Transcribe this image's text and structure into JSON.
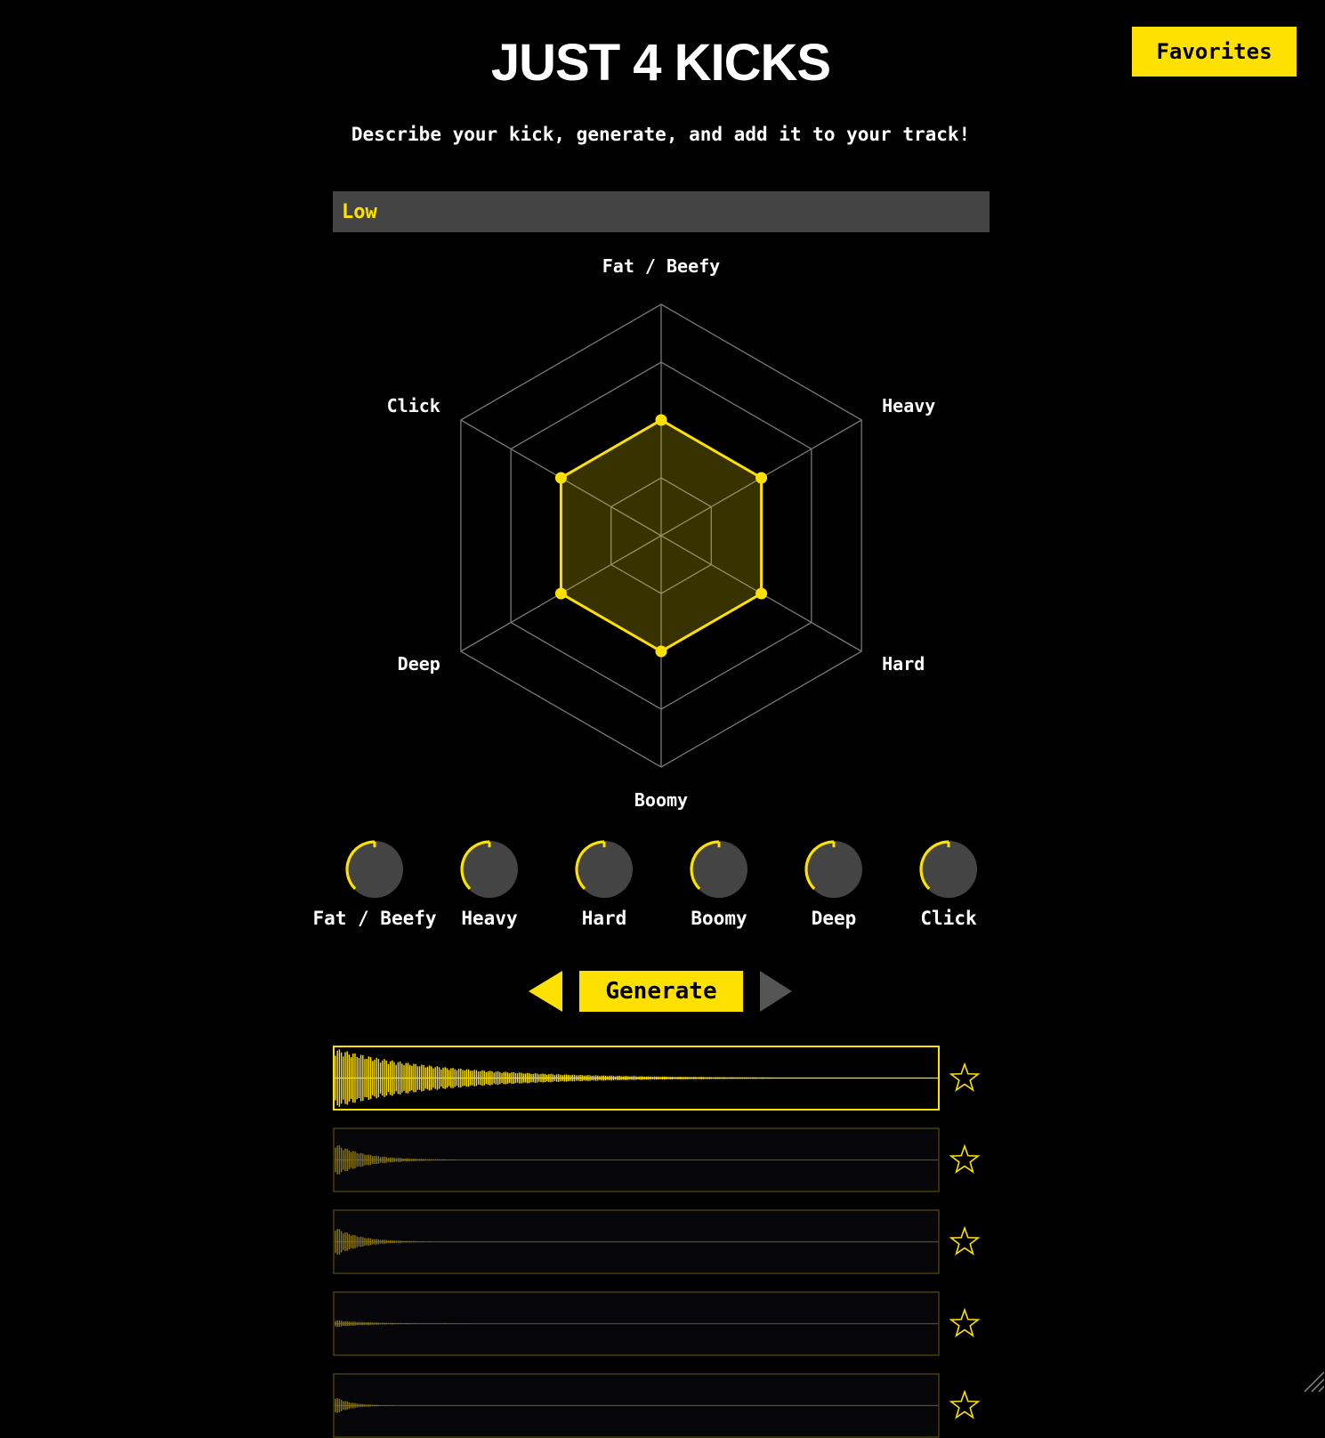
{
  "header": {
    "title": "JUST 4 KICKS",
    "subtitle": "Describe your kick, generate, and add it to your track!",
    "favorites_label": "Favorites"
  },
  "description": {
    "value": "Low"
  },
  "radar": {
    "axes": [
      "Fat / Beefy",
      "Heavy",
      "Hard",
      "Boomy",
      "Deep",
      "Click"
    ],
    "values": [
      0.5,
      0.5,
      0.5,
      0.5,
      0.5,
      0.5
    ],
    "rings": 4
  },
  "knobs": [
    {
      "label": "Fat / Beefy",
      "value": 0.5
    },
    {
      "label": "Heavy",
      "value": 0.5
    },
    {
      "label": "Hard",
      "value": 0.5
    },
    {
      "label": "Boomy",
      "value": 0.5
    },
    {
      "label": "Deep",
      "value": 0.5
    },
    {
      "label": "Click",
      "value": 0.5
    }
  ],
  "controls": {
    "generate_label": "Generate"
  },
  "samples": [
    {
      "selected": true,
      "amplitude": 1.0,
      "decay": 0.72,
      "favorite": false
    },
    {
      "selected": false,
      "amplitude": 0.55,
      "decay": 0.2,
      "favorite": false
    },
    {
      "selected": false,
      "amplitude": 0.5,
      "decay": 0.16,
      "favorite": false
    },
    {
      "selected": false,
      "amplitude": 0.12,
      "decay": 0.22,
      "favorite": false
    },
    {
      "selected": false,
      "amplitude": 0.3,
      "decay": 0.1,
      "favorite": false
    }
  ],
  "colors": {
    "accent": "#ffe100",
    "background": "#000000",
    "panel": "#444444",
    "grid": "#777777",
    "inactive_arrow": "#555555"
  }
}
